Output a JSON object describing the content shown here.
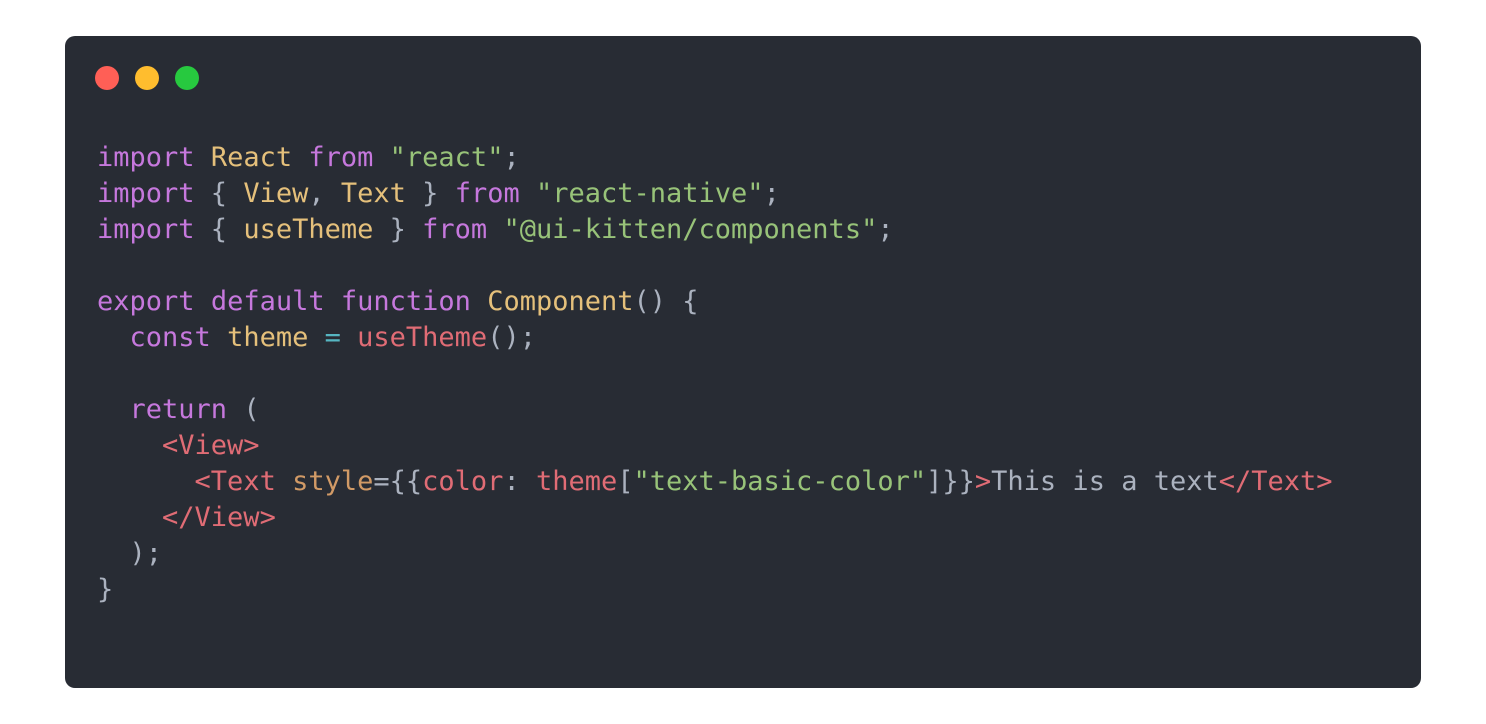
{
  "window": {
    "traffic_lights": [
      {
        "name": "close",
        "color": "#ff5f56"
      },
      {
        "name": "minimize",
        "color": "#ffbd2e"
      },
      {
        "name": "zoom",
        "color": "#27c93f"
      }
    ]
  },
  "theme": {
    "background": "#282c34",
    "keyword": "#c678dd",
    "class_name": "#e5c07b",
    "string": "#98c379",
    "function": "#e06c75",
    "tag": "#e06c75",
    "attribute": "#d19a66",
    "operator": "#56b6c2",
    "plain": "#abb2bf",
    "punctuation": "#abb2bf"
  },
  "code": {
    "lines": [
      [
        {
          "t": "import",
          "k": "keyword"
        },
        {
          "t": " ",
          "k": "plain"
        },
        {
          "t": "React",
          "k": "class_name"
        },
        {
          "t": " ",
          "k": "plain"
        },
        {
          "t": "from",
          "k": "keyword"
        },
        {
          "t": " ",
          "k": "plain"
        },
        {
          "t": "\"react\"",
          "k": "string"
        },
        {
          "t": ";",
          "k": "punctuation"
        }
      ],
      [
        {
          "t": "import",
          "k": "keyword"
        },
        {
          "t": " { ",
          "k": "punctuation"
        },
        {
          "t": "View",
          "k": "class_name"
        },
        {
          "t": ", ",
          "k": "punctuation"
        },
        {
          "t": "Text",
          "k": "class_name"
        },
        {
          "t": " } ",
          "k": "punctuation"
        },
        {
          "t": "from",
          "k": "keyword"
        },
        {
          "t": " ",
          "k": "plain"
        },
        {
          "t": "\"react-native\"",
          "k": "string"
        },
        {
          "t": ";",
          "k": "punctuation"
        }
      ],
      [
        {
          "t": "import",
          "k": "keyword"
        },
        {
          "t": " { ",
          "k": "punctuation"
        },
        {
          "t": "useTheme",
          "k": "class_name"
        },
        {
          "t": " } ",
          "k": "punctuation"
        },
        {
          "t": "from",
          "k": "keyword"
        },
        {
          "t": " ",
          "k": "plain"
        },
        {
          "t": "\"@ui-kitten/components\"",
          "k": "string"
        },
        {
          "t": ";",
          "k": "punctuation"
        }
      ],
      [],
      [
        {
          "t": "export",
          "k": "keyword"
        },
        {
          "t": " ",
          "k": "plain"
        },
        {
          "t": "default",
          "k": "keyword"
        },
        {
          "t": " ",
          "k": "plain"
        },
        {
          "t": "function",
          "k": "keyword"
        },
        {
          "t": " ",
          "k": "plain"
        },
        {
          "t": "Component",
          "k": "class_name"
        },
        {
          "t": "() {",
          "k": "punctuation"
        }
      ],
      [
        {
          "t": "  ",
          "k": "plain"
        },
        {
          "t": "const",
          "k": "keyword"
        },
        {
          "t": " ",
          "k": "plain"
        },
        {
          "t": "theme",
          "k": "class_name"
        },
        {
          "t": " ",
          "k": "plain"
        },
        {
          "t": "=",
          "k": "operator"
        },
        {
          "t": " ",
          "k": "plain"
        },
        {
          "t": "useTheme",
          "k": "function"
        },
        {
          "t": "();",
          "k": "punctuation"
        }
      ],
      [],
      [
        {
          "t": "  ",
          "k": "plain"
        },
        {
          "t": "return",
          "k": "keyword"
        },
        {
          "t": " (",
          "k": "punctuation"
        }
      ],
      [
        {
          "t": "    ",
          "k": "plain"
        },
        {
          "t": "<View>",
          "k": "tag"
        }
      ],
      [
        {
          "t": "      ",
          "k": "plain"
        },
        {
          "t": "<Text",
          "k": "tag"
        },
        {
          "t": " ",
          "k": "plain"
        },
        {
          "t": "style",
          "k": "attribute"
        },
        {
          "t": "={{",
          "k": "punctuation"
        },
        {
          "t": "color",
          "k": "function"
        },
        {
          "t": ": ",
          "k": "punctuation"
        },
        {
          "t": "theme",
          "k": "function"
        },
        {
          "t": "[",
          "k": "punctuation"
        },
        {
          "t": "\"text-basic-color\"",
          "k": "string"
        },
        {
          "t": "]}}",
          "k": "punctuation"
        },
        {
          "t": ">",
          "k": "tag"
        },
        {
          "t": "This is a text",
          "k": "plain"
        },
        {
          "t": "</Text>",
          "k": "tag"
        }
      ],
      [
        {
          "t": "    ",
          "k": "plain"
        },
        {
          "t": "</View>",
          "k": "tag"
        }
      ],
      [
        {
          "t": "  );",
          "k": "punctuation"
        }
      ],
      [
        {
          "t": "}",
          "k": "punctuation"
        }
      ]
    ]
  }
}
